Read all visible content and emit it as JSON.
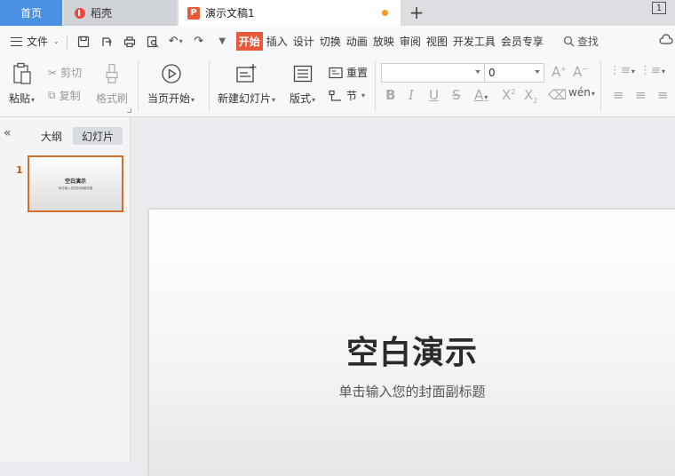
{
  "tabs": {
    "home": "首页",
    "daoke": "稻壳",
    "document": "演示文稿1",
    "new_tab": "+",
    "window_count": "1"
  },
  "menu": {
    "file": "文件",
    "tabs": [
      "开始",
      "插入",
      "设计",
      "切换",
      "动画",
      "放映",
      "审阅",
      "视图",
      "开发工具",
      "会员专享"
    ],
    "active_tab": "开始",
    "search": "查找"
  },
  "ribbon": {
    "paste": "粘贴",
    "cut": "剪切",
    "copy": "复制",
    "format_painter": "格式刷",
    "from_start": "当页开始",
    "new_slide": "新建幻灯片",
    "layout": "版式",
    "reset": "重置",
    "section": "节",
    "font_name": "",
    "font_size": "0"
  },
  "panel": {
    "outline_tab": "大纲",
    "slides_tab": "幻灯片",
    "slide_number": "1",
    "thumb_title": "空白演示",
    "thumb_subtitle": "单击输入您的封面副标题"
  },
  "slide": {
    "title": "空白演示",
    "subtitle": "单击输入您的封面副标题"
  },
  "colors": {
    "accent": "#e8593a",
    "home_tab": "#4a90e2",
    "selection_border": "#d0702c",
    "unsaved_dot": "#f0a020"
  }
}
